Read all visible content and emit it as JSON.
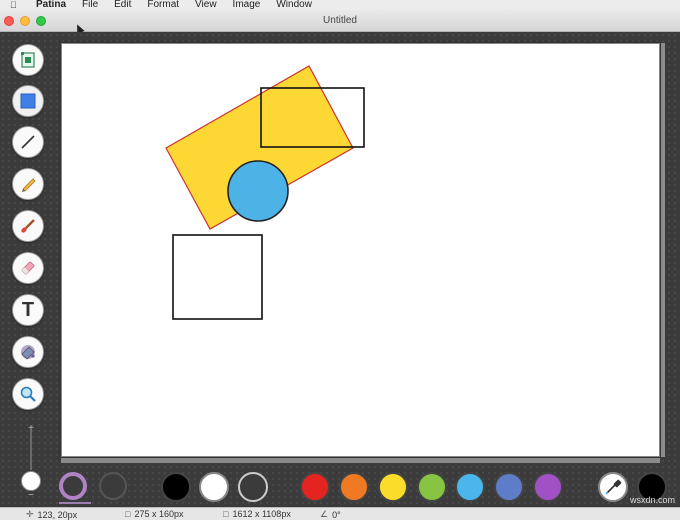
{
  "menubar": {
    "app_name": "Patina",
    "items": [
      "File",
      "Edit",
      "Format",
      "View",
      "Image",
      "Window"
    ]
  },
  "window": {
    "title": "Untitled"
  },
  "tools": [
    {
      "name": "canvas-tool",
      "icon": "canvas-icon"
    },
    {
      "name": "shape-tool",
      "icon": "square-icon"
    },
    {
      "name": "line-tool",
      "icon": "line-icon"
    },
    {
      "name": "pencil-tool",
      "icon": "pencil-icon"
    },
    {
      "name": "brush-tool",
      "icon": "brush-icon"
    },
    {
      "name": "eraser-tool",
      "icon": "eraser-icon"
    },
    {
      "name": "text-tool",
      "icon": "text-icon",
      "label": "T"
    },
    {
      "name": "fill-tool",
      "icon": "paint-bucket-icon"
    },
    {
      "name": "zoom-tool",
      "icon": "magnifier-icon"
    }
  ],
  "zoom": {
    "plus": "+",
    "minus": "−"
  },
  "palette": {
    "colors": [
      "#000000",
      "#ffffff",
      "#3b3b3b",
      "#e32421",
      "#f07a23",
      "#fbdc2b",
      "#86c441",
      "#4bb6ec",
      "#5e7cc7",
      "#a251c4",
      "#000000"
    ],
    "stroke_color": "#b083c6"
  },
  "shapes": {
    "rect_fill": "#fdd835",
    "rect_stroke": "#cc3333",
    "circle_fill": "#4db3e6"
  },
  "status": {
    "cursor_pos": "123, 20px",
    "selection_size": "275 x 160px",
    "canvas_size": "1612 x 1108px",
    "angle": "0°"
  },
  "watermark": "wsxdn.com"
}
